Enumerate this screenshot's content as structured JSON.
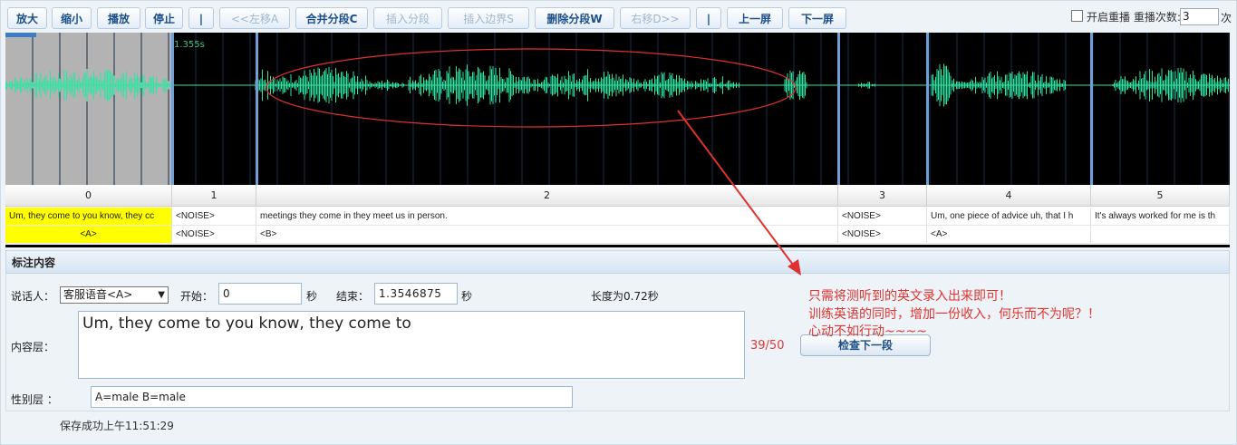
{
  "toolbar": {
    "zoom_in": "放大",
    "zoom_out": "缩小",
    "play": "播放",
    "stop": "停止",
    "divider1": "|",
    "move_left": "<<左移A",
    "merge": "合并分段C",
    "insert_segment": "插入分段",
    "insert_boundary": "插入边界S",
    "delete_segment": "删除分段W",
    "move_right": "右移D>>",
    "divider2": "|",
    "prev_screen": "上一屏",
    "next_screen": "下一屏",
    "replay_label": "开启重播 重播次数:",
    "replay_count": "3",
    "replay_unit": "次"
  },
  "wave": {
    "timestamp": "1.355s",
    "colors": {
      "background": "#000000",
      "waveform": "#2ee6a3",
      "selected_bg": "#b3b3b3",
      "boundary": "#6f9fd8",
      "ellipse": "#e03030"
    }
  },
  "segments": [
    {
      "index": "0",
      "text": "Um, they come to you know, they cc",
      "speaker": "<A>",
      "selected": true
    },
    {
      "index": "1",
      "text": "<NOISE>",
      "speaker": "<NOISE>",
      "selected": false
    },
    {
      "index": "2",
      "text": "meetings they come in they meet us in person.",
      "speaker": "<B>",
      "selected": false
    },
    {
      "index": "3",
      "text": "<NOISE>",
      "speaker": "<NOISE>",
      "selected": false
    },
    {
      "index": "4",
      "text": "Um, one piece of advice uh, that I h",
      "speaker": "<A>",
      "selected": false
    },
    {
      "index": "5",
      "text": "It's always worked for me is th",
      "speaker": "",
      "selected": false
    }
  ],
  "annotation": {
    "panel_title": "标注内容",
    "speaker_label": "说话人：",
    "speaker_value": "客服语音<A>",
    "start_label": "开始：",
    "start_value": "0",
    "sec1": "秒",
    "end_label": "结束：",
    "end_value": "1.3546875",
    "sec2": "秒",
    "length_text": "长度为0.72秒",
    "content_label": "内容层：",
    "content_value": "Um, they come to you know, they come to",
    "counter": "39/50",
    "check_next": "检查下一段",
    "gender_label": "性别层 ：",
    "gender_value": "A=male B=male"
  },
  "note": {
    "line1": "只需将测听到的英文录入出来即可！",
    "line2": "训练英语的同时，增加一份收入，何乐而不为呢？！",
    "line3": "心动不如行动~~~~"
  },
  "status": {
    "saved": "保存成功上午11:51:29"
  }
}
